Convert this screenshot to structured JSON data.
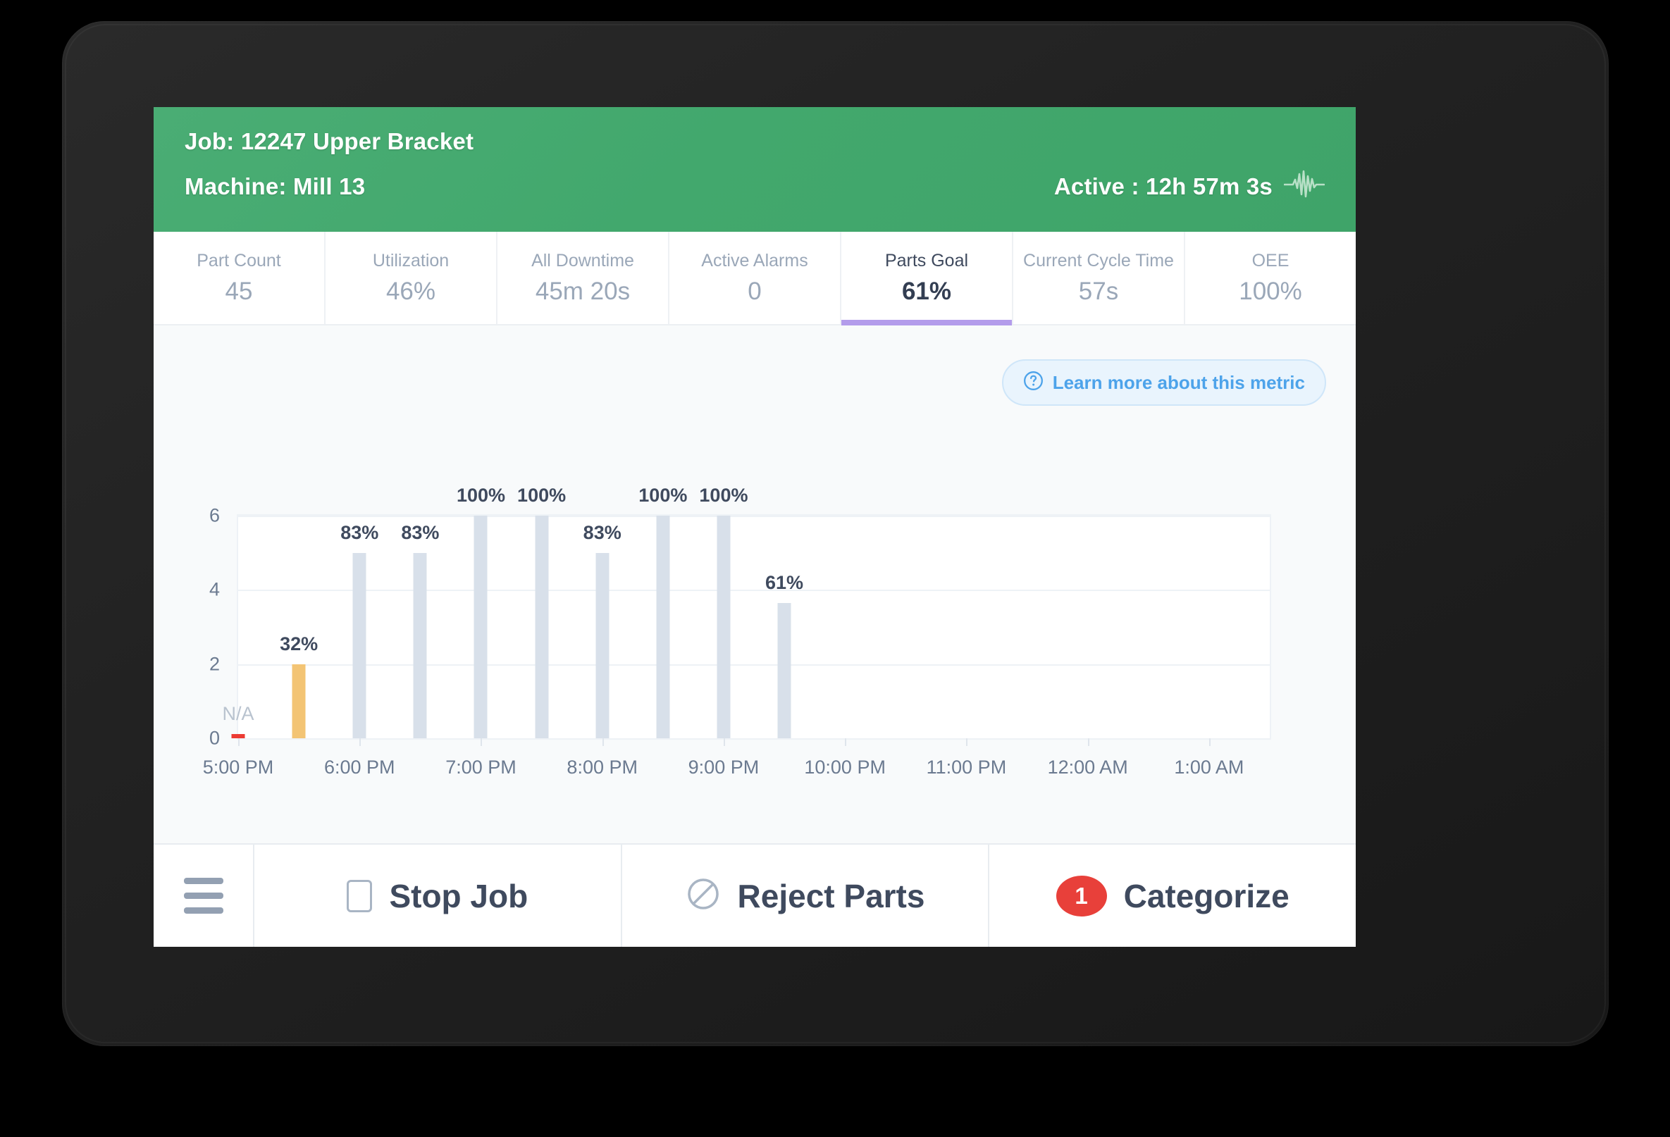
{
  "header": {
    "job_label": "Job: 12247 Upper Bracket",
    "machine_label": "Machine: Mill 13",
    "status_label": "Active : 12h 57m 3s",
    "pulse_icon": "waveform-pulse-icon",
    "background_color": "#42a86d"
  },
  "metric_tabs": [
    {
      "label": "Part Count",
      "value": "45",
      "active": false
    },
    {
      "label": "Utilization",
      "value": "46%",
      "active": false
    },
    {
      "label": "All Downtime",
      "value": "45m 20s",
      "active": false
    },
    {
      "label": "Active Alarms",
      "value": "0",
      "active": false
    },
    {
      "label": "Parts Goal",
      "value": "61%",
      "active": true
    },
    {
      "label": "Current Cycle Time",
      "value": "57s",
      "active": false
    },
    {
      "label": "OEE",
      "value": "100%",
      "active": false
    }
  ],
  "active_tab_underline_color": "#b39ceb",
  "learn_more": {
    "label": "Learn more about this metric",
    "icon": "question-circle-icon",
    "text_color": "#4da3ea",
    "background_color": "#e9f4fd"
  },
  "chart_data": {
    "type": "bar",
    "title": "",
    "xlabel": "",
    "ylabel": "",
    "ylim": [
      0,
      6
    ],
    "yticks": [
      0,
      2,
      4,
      6
    ],
    "grid": true,
    "legend": "none",
    "xticks": [
      "5:00 PM",
      "6:00 PM",
      "7:00 PM",
      "8:00 PM",
      "9:00 PM",
      "10:00 PM",
      "11:00 PM",
      "12:00 AM",
      "1:00 AM"
    ],
    "x_axis_start": "5:00 PM",
    "x_axis_end": "1:30 AM",
    "bar_colors": {
      "normal": "#d8e0ea",
      "warn": "#f3c474",
      "alert": "#ec3b33"
    },
    "points": [
      {
        "time": "5:00 PM",
        "value": 0.08,
        "label": "N/A",
        "color": "alert",
        "label_style": "na"
      },
      {
        "time": "5:30 PM",
        "value": 2,
        "label": "32%",
        "color": "warn",
        "label_style": "normal"
      },
      {
        "time": "6:00 PM",
        "value": 5,
        "label": "83%",
        "color": "normal",
        "label_style": "normal"
      },
      {
        "time": "6:30 PM",
        "value": 5,
        "label": "83%",
        "color": "normal",
        "label_style": "normal"
      },
      {
        "time": "7:00 PM",
        "value": 6,
        "label": "100%",
        "color": "normal",
        "label_style": "normal"
      },
      {
        "time": "7:30 PM",
        "value": 6,
        "label": "100%",
        "color": "normal",
        "label_style": "normal"
      },
      {
        "time": "8:00 PM",
        "value": 5,
        "label": "83%",
        "color": "normal",
        "label_style": "normal"
      },
      {
        "time": "8:30 PM",
        "value": 6,
        "label": "100%",
        "color": "normal",
        "label_style": "normal"
      },
      {
        "time": "9:00 PM",
        "value": 6,
        "label": "100%",
        "color": "normal",
        "label_style": "normal"
      },
      {
        "time": "9:30 PM",
        "value": 3.65,
        "label": "61%",
        "color": "normal",
        "label_style": "normal"
      }
    ]
  },
  "action_bar": {
    "menu_icon": "hamburger-menu-icon",
    "buttons": [
      {
        "label": "Stop Job",
        "icon": "stop-square-icon",
        "badge": null
      },
      {
        "label": "Reject Parts",
        "icon": "no-entry-icon",
        "badge": null
      },
      {
        "label": "Categorize",
        "icon": "count-badge",
        "badge": "1"
      }
    ],
    "badge_color": "#e8403a"
  }
}
